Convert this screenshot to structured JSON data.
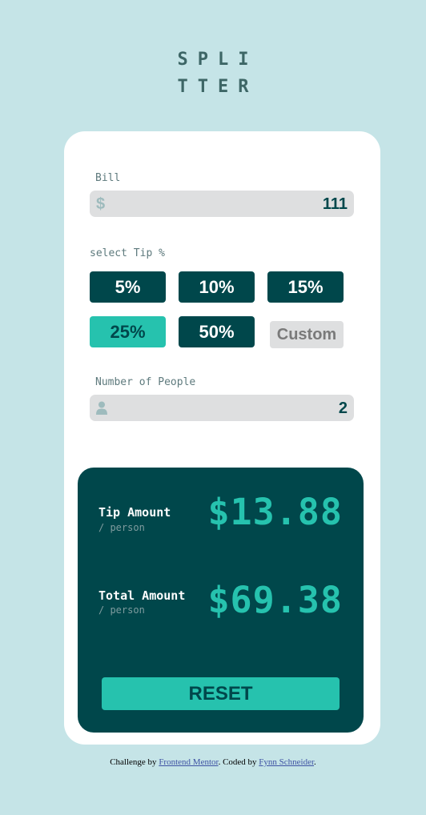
{
  "app": {
    "logo_line1": "SPLI",
    "logo_line2": "TTER"
  },
  "bill": {
    "label": "Bill",
    "currency_symbol": "$",
    "value": "111"
  },
  "tip": {
    "label": "select Tip %",
    "options": [
      {
        "label": "5%",
        "active": false
      },
      {
        "label": "10%",
        "active": false
      },
      {
        "label": "15%",
        "active": false
      },
      {
        "label": "25%",
        "active": true
      },
      {
        "label": "50%",
        "active": false
      }
    ],
    "custom_label": "Custom"
  },
  "people": {
    "label": "Number of People",
    "icon": "person-icon",
    "value": "2"
  },
  "results": {
    "tip_title": "Tip Amount",
    "tip_sub": "/ person",
    "tip_value": "$13.88",
    "total_title": "Total Amount",
    "total_sub": "/ person",
    "total_value": "$69.38",
    "reset_label": "RESET"
  },
  "footer": {
    "prefix": "Challenge by",
    "link1": "Frontend Mentor",
    "middle": ". Coded by",
    "link2": "Fynn Schneider",
    "suffix": "."
  },
  "colors": {
    "background": "#c5e4e7",
    "dark_teal": "#00474b",
    "accent": "#26c2ae",
    "input_bg": "#dedfe0"
  }
}
